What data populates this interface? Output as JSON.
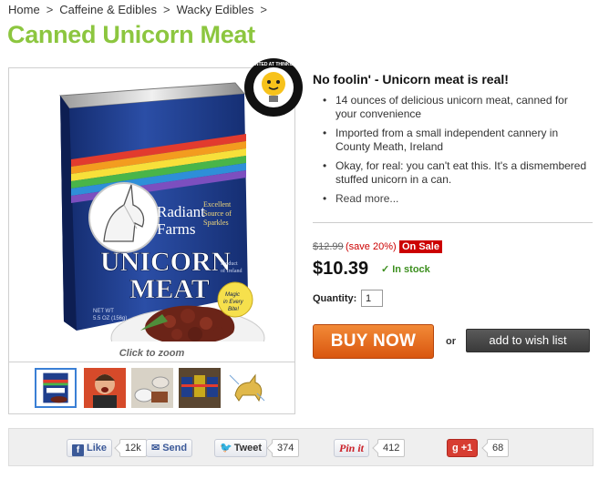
{
  "breadcrumb": {
    "items": [
      "Home",
      "Caffeine & Edibles",
      "Wacky Edibles"
    ],
    "separator": ">"
  },
  "product": {
    "title": "Canned Unicorn Meat",
    "headline": "No foolin' - Unicorn meat is real!",
    "features": [
      "14 ounces of delicious unicorn meat, canned for your convenience",
      "Imported from a small independent cannery in County Meath, Ireland",
      "Okay, for real: you can't eat this. It's a dismembered stuffed unicorn in a can."
    ],
    "read_more": "Read more...",
    "zoom_label": "Click to zoom",
    "badge_text": "INVENTED AT THINKGEEK",
    "can": {
      "brand_line1": "Radiant",
      "brand_line2": "Farms",
      "tagline_line1": "Excellent",
      "tagline_line2": "Source of",
      "tagline_line3": "Sparkles",
      "name_line1": "UNICORN",
      "name_line2": "MEAT",
      "origin_line1": "Product",
      "origin_line2": "of Ireland",
      "magic_line1": "Magic",
      "magic_line2": "in Every",
      "magic_line3": "Bite!",
      "net_wt_line1": "NET WT",
      "net_wt_line2": "5.5 OZ (156g)"
    }
  },
  "pricing": {
    "old_price": "$12.99",
    "savings": "(save 20%)",
    "sale_badge": "On Sale",
    "price": "$10.39",
    "stock": "In stock",
    "quantity_label": "Quantity:",
    "quantity_value": "1"
  },
  "actions": {
    "buy_now": "BUY NOW",
    "or": "or",
    "wish_list": "add to wish list"
  },
  "share": {
    "like": "Like",
    "like_count": "12k",
    "send": "Send",
    "tweet": "Tweet",
    "tweet_count": "374",
    "pinit": "Pin it",
    "pin_count": "412",
    "gplus": "+1",
    "gplus_count": "68"
  },
  "colors": {
    "title_green": "#8cc63f",
    "buy_orange": "#e5661c",
    "sale_red": "#cc0000",
    "stock_green": "#3c8f1e",
    "can_blue": "#1f3e8c"
  }
}
